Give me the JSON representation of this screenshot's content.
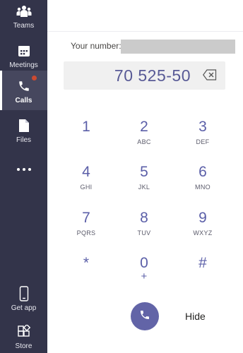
{
  "sidebar": {
    "items": [
      {
        "label": "Teams",
        "icon": "teams-icon"
      },
      {
        "label": "Meetings",
        "icon": "calendar-icon"
      },
      {
        "label": "Calls",
        "icon": "phone-icon",
        "active": true,
        "has_notification": true
      },
      {
        "label": "Files",
        "icon": "file-icon"
      },
      {
        "label": "Get app",
        "icon": "mobile-device-icon"
      },
      {
        "label": "Store",
        "icon": "store-icon"
      }
    ],
    "more_icon": "ellipsis-icon"
  },
  "dialer": {
    "your_number_label": "Your number:",
    "number_value": "70 525-50",
    "backspace_icon": "backspace-icon",
    "keys": [
      {
        "digit": "1",
        "letters": ""
      },
      {
        "digit": "2",
        "letters": "ABC"
      },
      {
        "digit": "3",
        "letters": "DEF"
      },
      {
        "digit": "4",
        "letters": "GHI"
      },
      {
        "digit": "5",
        "letters": "JKL"
      },
      {
        "digit": "6",
        "letters": "MNO"
      },
      {
        "digit": "7",
        "letters": "PQRS"
      },
      {
        "digit": "8",
        "letters": "TUV"
      },
      {
        "digit": "9",
        "letters": "WXYZ"
      },
      {
        "digit": "*",
        "letters": ""
      },
      {
        "digit": "0",
        "letters": "+"
      },
      {
        "digit": "#",
        "letters": ""
      }
    ],
    "call_icon": "phone-icon",
    "hide_label": "Hide"
  },
  "colors": {
    "sidebar_bg": "#33344a",
    "accent": "#6264a7",
    "digit_text": "#5b5fa8",
    "notification": "#cc4a31"
  }
}
